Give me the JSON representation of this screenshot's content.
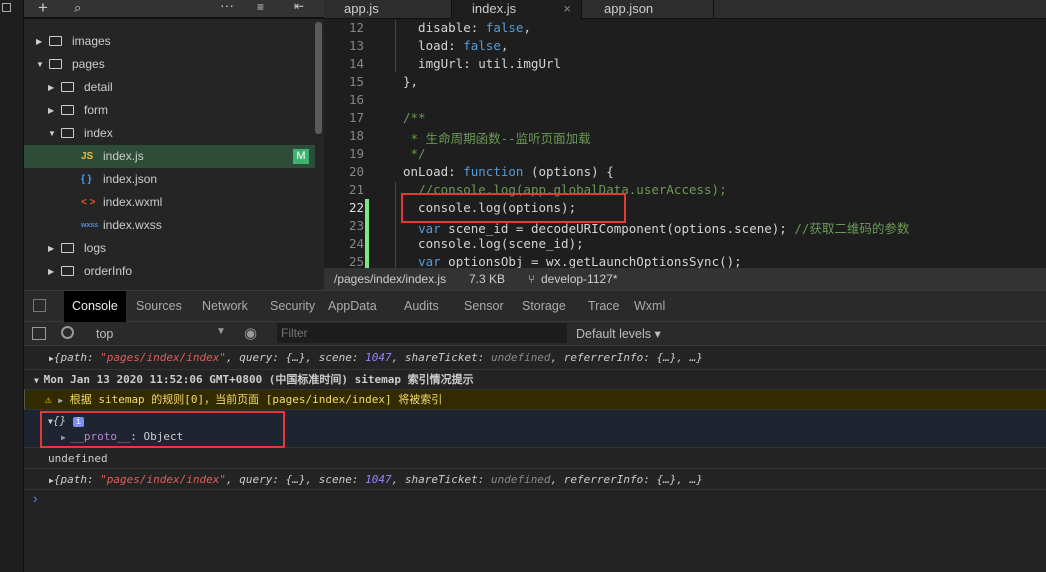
{
  "tree": {
    "toolbar_icons": [
      "add-icon",
      "search-icon",
      "more-icon",
      "collapse-icon",
      "split-icon"
    ],
    "items": [
      {
        "label": "images",
        "type": "folder",
        "open": false,
        "depth": 0
      },
      {
        "label": "pages",
        "type": "folder",
        "open": true,
        "depth": 0
      },
      {
        "label": "detail",
        "type": "folder",
        "open": false,
        "depth": 1
      },
      {
        "label": "form",
        "type": "folder",
        "open": false,
        "depth": 1
      },
      {
        "label": "index",
        "type": "folder",
        "open": true,
        "depth": 1
      },
      {
        "label": "index.js",
        "type": "js",
        "icon": "JS",
        "badge": "M",
        "selected": true,
        "depth": 2
      },
      {
        "label": "index.json",
        "type": "json",
        "icon": "{ }",
        "depth": 2
      },
      {
        "label": "index.wxml",
        "type": "wxml",
        "icon": "< >",
        "depth": 2
      },
      {
        "label": "index.wxss",
        "type": "wxss",
        "icon": "wxss",
        "depth": 2
      },
      {
        "label": "logs",
        "type": "folder",
        "open": false,
        "depth": 1
      },
      {
        "label": "orderInfo",
        "type": "folder",
        "open": false,
        "depth": 1
      }
    ]
  },
  "editor": {
    "tabs": [
      {
        "label": "app.js"
      },
      {
        "label": "index.js",
        "active": true,
        "close": "×"
      },
      {
        "label": "app.json"
      }
    ],
    "lines": [
      {
        "n": "12",
        "html": "  disable: <span class='kw'>false</span>,"
      },
      {
        "n": "13",
        "html": "  load: <span class='kw'>false</span>,"
      },
      {
        "n": "14",
        "html": "  imgUrl: util.imgUrl"
      },
      {
        "n": "15",
        "html": "},"
      },
      {
        "n": "16",
        "html": ""
      },
      {
        "n": "17",
        "html": "<span class='cm'>/**</span>"
      },
      {
        "n": "18",
        "html": "<span class='cm'> * 生命周期函数--监听页面加载</span>"
      },
      {
        "n": "19",
        "html": "<span class='cm'> */</span>"
      },
      {
        "n": "20",
        "html": "onLoad: <span class='kw'>function</span> (options) {"
      },
      {
        "n": "21",
        "html": "  <span class='cm'>//console.log(app.globalData.userAccess);</span>"
      },
      {
        "n": "22",
        "html": "  console.log(options);"
      },
      {
        "n": "23",
        "html": "  <span class='kw'>var</span> scene_id = decodeURIComponent(options.scene); <span class='cm'>//获取二维码的参数</span>"
      },
      {
        "n": "24",
        "html": "  console.log(scene_id);"
      },
      {
        "n": "25",
        "html": "  <span class='kw'>var</span> optionsObj = wx.getLaunchOptionsSync();"
      }
    ],
    "status": {
      "path": "/pages/index/index.js",
      "size": "7.3 KB",
      "branch": "develop-1127*"
    }
  },
  "devtools": {
    "tabs": [
      "Console",
      "Sources",
      "Network",
      "Security",
      "AppData",
      "Audits",
      "Sensor",
      "Storage",
      "Trace",
      "Wxml"
    ],
    "active_tab": "Console",
    "context": "top",
    "filter_placeholder": "Filter",
    "levels": "Default levels ▾",
    "console": {
      "log1": "{path: \"pages/index/index\", query: {…}, scene: 1047, shareTicket: undefined, referrerInfo: {…}, …}",
      "group": "Mon Jan 13 2020 11:52:06 GMT+0800 (中国标准时间) sitemap 索引情况提示",
      "warning": "根据 sitemap 的规则[0]，当前页面 [pages/index/index] 将被索引",
      "obj": "{}",
      "info_badge": "i",
      "proto_key": "__proto__",
      "proto_val": ": Object",
      "undef": "undefined",
      "log2": "{path: \"pages/index/index\", query: {…}, scene: 1047, shareTicket: undefined, referrerInfo: {…}, …}",
      "prompt": "›"
    }
  },
  "colors": {
    "selected": "#2d4d39",
    "highlight_box": "#e53935",
    "warning_bg": "#332b00",
    "modified_gutter": "#7ee787"
  }
}
